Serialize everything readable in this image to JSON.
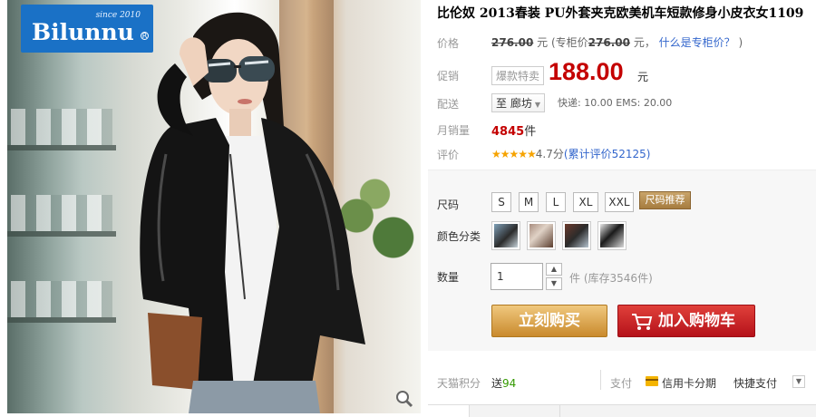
{
  "brand": {
    "name": "Bilunnu",
    "since": "since 2010",
    "reg": "R"
  },
  "product": {
    "title": "比伦奴 2013春装 PU外套夹克欧美机车短款修身小皮衣女1109"
  },
  "price": {
    "label": "价格",
    "original": "276.00",
    "original_unit": "元",
    "counter_prefix": "(专柜价",
    "counter_value": "276.00",
    "counter_suffix": "元，",
    "counter_link": "什么是专柜价？",
    "counter_close": ")"
  },
  "promo": {
    "label": "促销",
    "tag": "爆款特卖",
    "price": "188.00",
    "unit": "元"
  },
  "shipping": {
    "label": "配送",
    "destination": "至 廊坊",
    "fees": "快递: 10.00 EMS: 20.00"
  },
  "sales": {
    "label": "月销量",
    "count": "4845",
    "unit": "件"
  },
  "rating": {
    "label": "评价",
    "stars": "★★★★★",
    "score": "4.7分",
    "link": "(累计评价52125)"
  },
  "size": {
    "label": "尺码",
    "options": [
      "S",
      "M",
      "L",
      "XL",
      "XXL"
    ],
    "recommend": "尺码推荐"
  },
  "color": {
    "label": "颜色分类",
    "swatches": [
      "swatch-1",
      "swatch-2",
      "swatch-3",
      "swatch-4"
    ]
  },
  "quantity": {
    "label": "数量",
    "value": "1",
    "unit": "件",
    "stock": "(库存3546件)"
  },
  "actions": {
    "buy_now": "立刻购买",
    "add_cart": "加入购物车"
  },
  "footer": {
    "points_label": "天猫积分",
    "points_prefix": "送",
    "points_value": "94",
    "pay_label": "支付",
    "card_installment": "信用卡分期",
    "quick_pay": "快捷支付"
  },
  "colors": {
    "price_red": "#c40000",
    "link_blue": "#3366cc",
    "buy_gold": "#c98a2d",
    "cart_red": "#b5121a",
    "brand_blue": "#1a71c6"
  }
}
